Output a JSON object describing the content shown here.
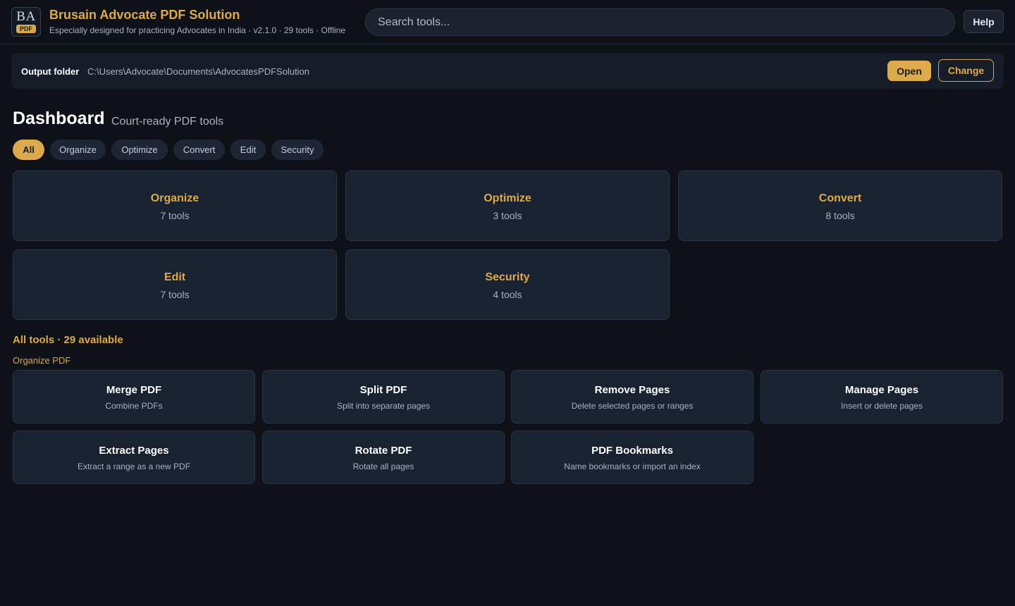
{
  "app": {
    "logo_text": "BA",
    "logo_badge": "PDF",
    "title": "Brusain Advocate PDF Solution",
    "subtitle": "Especially designed for practicing Advocates in India · v2.1.0 · 29 tools · Offline"
  },
  "search": {
    "placeholder": "Search tools..."
  },
  "header": {
    "help_label": "Help"
  },
  "output": {
    "label": "Output folder",
    "path": "C:\\Users\\Advocate\\Documents\\AdvocatesPDFSolution",
    "open_label": "Open",
    "change_label": "Change"
  },
  "dashboard": {
    "title": "Dashboard",
    "subtitle": "Court-ready PDF tools",
    "filters": [
      {
        "label": "All",
        "active": true
      },
      {
        "label": "Organize",
        "active": false
      },
      {
        "label": "Optimize",
        "active": false
      },
      {
        "label": "Convert",
        "active": false
      },
      {
        "label": "Edit",
        "active": false
      },
      {
        "label": "Security",
        "active": false
      }
    ],
    "categories": [
      {
        "name": "Organize",
        "count": "7 tools"
      },
      {
        "name": "Optimize",
        "count": "3 tools"
      },
      {
        "name": "Convert",
        "count": "8 tools"
      },
      {
        "name": "Edit",
        "count": "7 tools"
      },
      {
        "name": "Security",
        "count": "4 tools"
      }
    ]
  },
  "tools": {
    "title": "All tools · 29 available",
    "section": "Organize PDF",
    "items": [
      {
        "name": "Merge PDF",
        "desc": "Combine PDFs"
      },
      {
        "name": "Split PDF",
        "desc": "Split into separate pages"
      },
      {
        "name": "Remove Pages",
        "desc": "Delete selected pages or ranges"
      },
      {
        "name": "Manage Pages",
        "desc": "Insert or delete pages"
      },
      {
        "name": "Extract Pages",
        "desc": "Extract a range as a new PDF"
      },
      {
        "name": "Rotate PDF",
        "desc": "Rotate all pages"
      },
      {
        "name": "PDF Bookmarks",
        "desc": "Name bookmarks or import an index"
      }
    ]
  },
  "colors": {
    "accent": "#dcaa4c",
    "background": "#0e1218",
    "card": "#192230"
  }
}
